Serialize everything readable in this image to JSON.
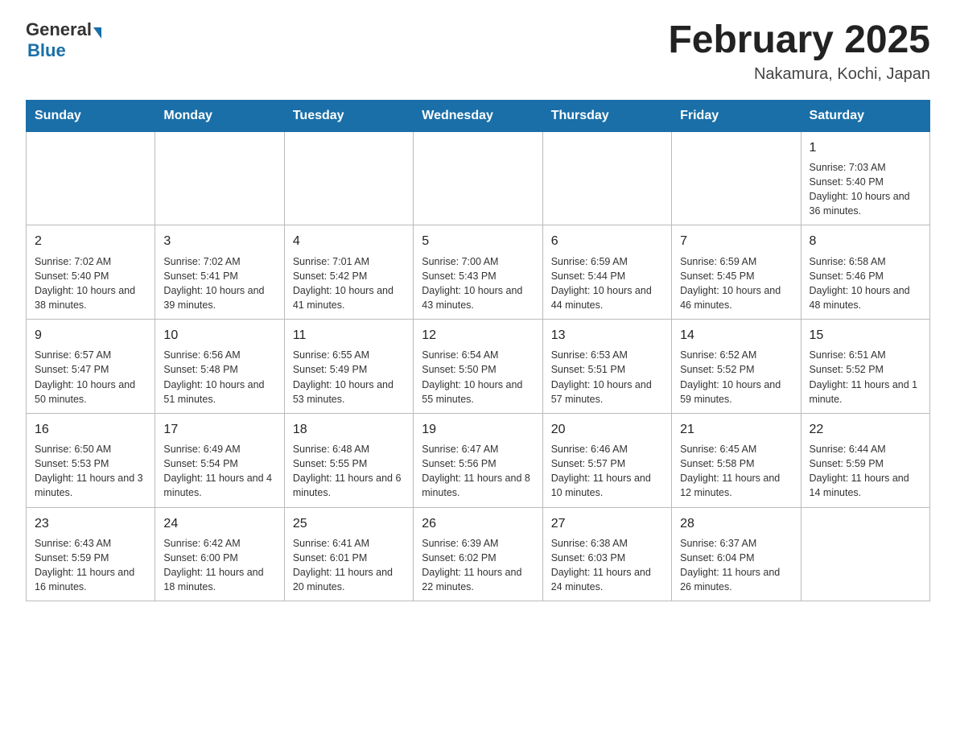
{
  "header": {
    "logo_general": "General",
    "logo_blue": "Blue",
    "month_title": "February 2025",
    "location": "Nakamura, Kochi, Japan"
  },
  "weekdays": [
    "Sunday",
    "Monday",
    "Tuesday",
    "Wednesday",
    "Thursday",
    "Friday",
    "Saturday"
  ],
  "weeks": [
    [
      {
        "day": "",
        "info": ""
      },
      {
        "day": "",
        "info": ""
      },
      {
        "day": "",
        "info": ""
      },
      {
        "day": "",
        "info": ""
      },
      {
        "day": "",
        "info": ""
      },
      {
        "day": "",
        "info": ""
      },
      {
        "day": "1",
        "info": "Sunrise: 7:03 AM\nSunset: 5:40 PM\nDaylight: 10 hours and 36 minutes."
      }
    ],
    [
      {
        "day": "2",
        "info": "Sunrise: 7:02 AM\nSunset: 5:40 PM\nDaylight: 10 hours and 38 minutes."
      },
      {
        "day": "3",
        "info": "Sunrise: 7:02 AM\nSunset: 5:41 PM\nDaylight: 10 hours and 39 minutes."
      },
      {
        "day": "4",
        "info": "Sunrise: 7:01 AM\nSunset: 5:42 PM\nDaylight: 10 hours and 41 minutes."
      },
      {
        "day": "5",
        "info": "Sunrise: 7:00 AM\nSunset: 5:43 PM\nDaylight: 10 hours and 43 minutes."
      },
      {
        "day": "6",
        "info": "Sunrise: 6:59 AM\nSunset: 5:44 PM\nDaylight: 10 hours and 44 minutes."
      },
      {
        "day": "7",
        "info": "Sunrise: 6:59 AM\nSunset: 5:45 PM\nDaylight: 10 hours and 46 minutes."
      },
      {
        "day": "8",
        "info": "Sunrise: 6:58 AM\nSunset: 5:46 PM\nDaylight: 10 hours and 48 minutes."
      }
    ],
    [
      {
        "day": "9",
        "info": "Sunrise: 6:57 AM\nSunset: 5:47 PM\nDaylight: 10 hours and 50 minutes."
      },
      {
        "day": "10",
        "info": "Sunrise: 6:56 AM\nSunset: 5:48 PM\nDaylight: 10 hours and 51 minutes."
      },
      {
        "day": "11",
        "info": "Sunrise: 6:55 AM\nSunset: 5:49 PM\nDaylight: 10 hours and 53 minutes."
      },
      {
        "day": "12",
        "info": "Sunrise: 6:54 AM\nSunset: 5:50 PM\nDaylight: 10 hours and 55 minutes."
      },
      {
        "day": "13",
        "info": "Sunrise: 6:53 AM\nSunset: 5:51 PM\nDaylight: 10 hours and 57 minutes."
      },
      {
        "day": "14",
        "info": "Sunrise: 6:52 AM\nSunset: 5:52 PM\nDaylight: 10 hours and 59 minutes."
      },
      {
        "day": "15",
        "info": "Sunrise: 6:51 AM\nSunset: 5:52 PM\nDaylight: 11 hours and 1 minute."
      }
    ],
    [
      {
        "day": "16",
        "info": "Sunrise: 6:50 AM\nSunset: 5:53 PM\nDaylight: 11 hours and 3 minutes."
      },
      {
        "day": "17",
        "info": "Sunrise: 6:49 AM\nSunset: 5:54 PM\nDaylight: 11 hours and 4 minutes."
      },
      {
        "day": "18",
        "info": "Sunrise: 6:48 AM\nSunset: 5:55 PM\nDaylight: 11 hours and 6 minutes."
      },
      {
        "day": "19",
        "info": "Sunrise: 6:47 AM\nSunset: 5:56 PM\nDaylight: 11 hours and 8 minutes."
      },
      {
        "day": "20",
        "info": "Sunrise: 6:46 AM\nSunset: 5:57 PM\nDaylight: 11 hours and 10 minutes."
      },
      {
        "day": "21",
        "info": "Sunrise: 6:45 AM\nSunset: 5:58 PM\nDaylight: 11 hours and 12 minutes."
      },
      {
        "day": "22",
        "info": "Sunrise: 6:44 AM\nSunset: 5:59 PM\nDaylight: 11 hours and 14 minutes."
      }
    ],
    [
      {
        "day": "23",
        "info": "Sunrise: 6:43 AM\nSunset: 5:59 PM\nDaylight: 11 hours and 16 minutes."
      },
      {
        "day": "24",
        "info": "Sunrise: 6:42 AM\nSunset: 6:00 PM\nDaylight: 11 hours and 18 minutes."
      },
      {
        "day": "25",
        "info": "Sunrise: 6:41 AM\nSunset: 6:01 PM\nDaylight: 11 hours and 20 minutes."
      },
      {
        "day": "26",
        "info": "Sunrise: 6:39 AM\nSunset: 6:02 PM\nDaylight: 11 hours and 22 minutes."
      },
      {
        "day": "27",
        "info": "Sunrise: 6:38 AM\nSunset: 6:03 PM\nDaylight: 11 hours and 24 minutes."
      },
      {
        "day": "28",
        "info": "Sunrise: 6:37 AM\nSunset: 6:04 PM\nDaylight: 11 hours and 26 minutes."
      },
      {
        "day": "",
        "info": ""
      }
    ]
  ]
}
